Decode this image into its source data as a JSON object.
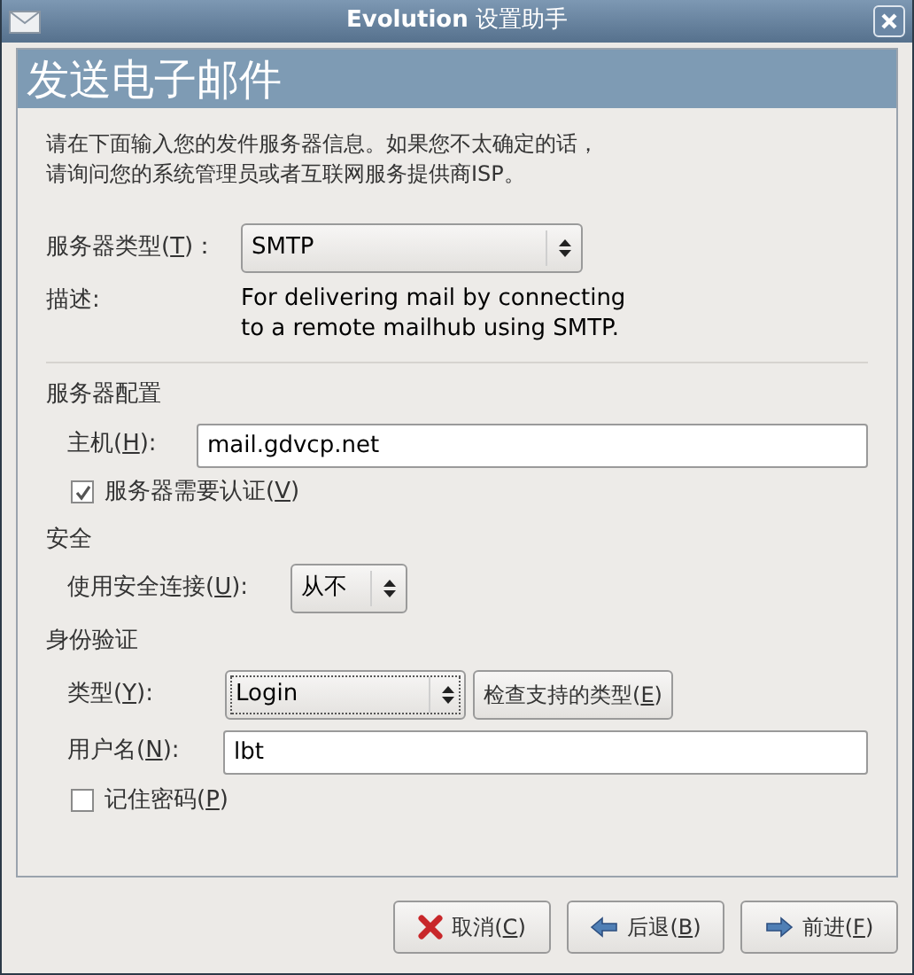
{
  "window": {
    "title_main": "Evolution",
    "title_rest": "设置助手"
  },
  "page_title": "发送电子邮件",
  "intro": [
    "请在下面输入您的发件服务器信息。如果您不太确定的话，",
    "请询问您的系统管理员或者互联网服务提供商ISP。"
  ],
  "server_type": {
    "label": [
      "服务器类型(",
      "T",
      ")："
    ],
    "value": "SMTP"
  },
  "description": {
    "label": "描述:",
    "text": "For delivering mail by connecting\nto a remote mailhub using SMTP."
  },
  "server_config": {
    "heading": "服务器配置",
    "host": {
      "label": [
        "主机(",
        "H",
        "):"
      ],
      "value": "mail.gdvcp.net"
    },
    "auth_required": {
      "label": [
        "服务器需要认证(",
        "V",
        ")"
      ],
      "checked": true
    }
  },
  "security": {
    "heading": "安全",
    "secure": {
      "label": [
        "使用安全连接(",
        "U",
        "):"
      ],
      "value": "从不"
    }
  },
  "authentication": {
    "heading": "身份验证",
    "type": {
      "label": [
        "类型(",
        "Y",
        "):"
      ],
      "value": "Login"
    },
    "check_button": [
      "检查支持的类型(",
      "E",
      ")"
    ],
    "username": {
      "label": [
        "用户名(",
        "N",
        "):"
      ],
      "value": "lbt"
    },
    "remember": {
      "label": [
        "记住密码(",
        "P",
        ")"
      ],
      "checked": false
    }
  },
  "buttons": [
    {
      "kind": "cancel",
      "label": [
        "取消(",
        "C",
        ")"
      ]
    },
    {
      "kind": "back",
      "label": [
        "后退(",
        "B",
        ")"
      ]
    },
    {
      "kind": "forward",
      "label": [
        "前进(",
        "F",
        ")"
      ]
    }
  ]
}
